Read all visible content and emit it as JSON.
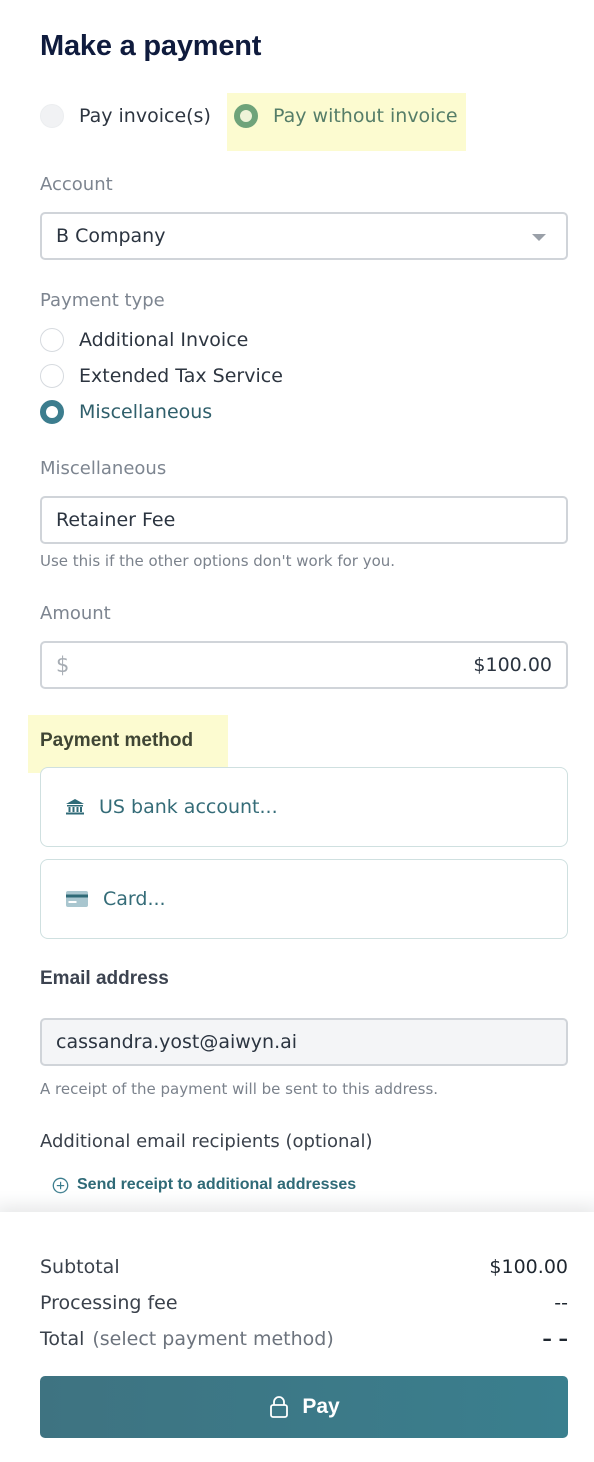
{
  "title": "Make a payment",
  "payment_mode": {
    "options": [
      {
        "label": "Pay invoice(s)",
        "selected": false
      },
      {
        "label": "Pay without invoice",
        "selected": true
      }
    ]
  },
  "account": {
    "label": "Account",
    "value": "B Company"
  },
  "payment_type": {
    "label": "Payment type",
    "options": [
      {
        "label": "Additional Invoice",
        "selected": false
      },
      {
        "label": "Extended Tax Service",
        "selected": false
      },
      {
        "label": "Miscellaneous",
        "selected": true
      }
    ]
  },
  "miscellaneous": {
    "label": "Miscellaneous",
    "value": "Retainer Fee",
    "helper": "Use this if the other options don't work for you."
  },
  "amount": {
    "label": "Amount",
    "currency_symbol": "$",
    "value": "$100.00"
  },
  "payment_method": {
    "label": "Payment method",
    "options": [
      {
        "label": "US bank account...",
        "icon": "bank-icon"
      },
      {
        "label": "Card...",
        "icon": "credit-card-icon"
      }
    ]
  },
  "email": {
    "label": "Email address",
    "value": "cassandra.yost@aiwyn.ai",
    "helper": "A receipt of the payment will be sent to this address."
  },
  "additional_recipients": {
    "label": "Additional email recipients (optional)",
    "link": "Send receipt to additional addresses"
  },
  "summary": {
    "subtotal_label": "Subtotal",
    "subtotal_value": "$100.00",
    "fee_label": "Processing fee",
    "fee_value": "--",
    "total_label": "Total",
    "total_note": "(select payment method)",
    "total_value": "– –"
  },
  "pay_button": {
    "label": "Pay",
    "icon": "lock-icon"
  },
  "colors": {
    "accent": "#3c7d8e",
    "highlight": "#fcfbd0",
    "title": "#0f1b3d"
  }
}
